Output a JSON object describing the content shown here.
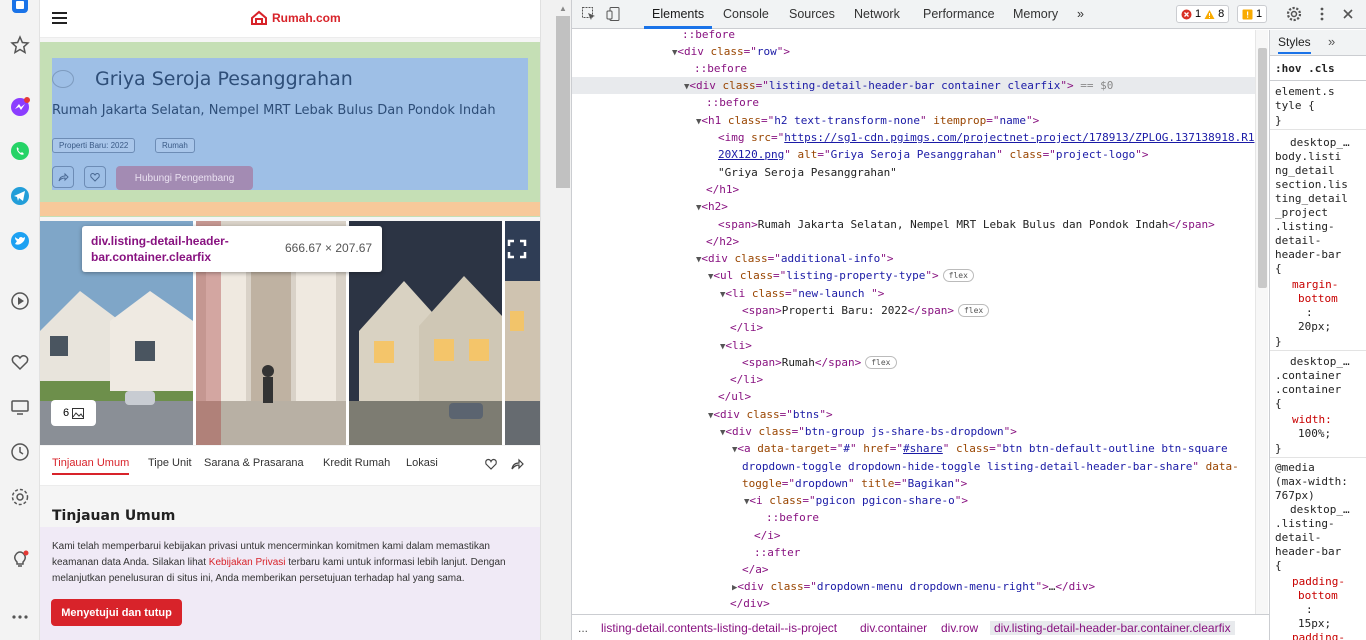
{
  "sidebar": {
    "icons": [
      "app-icon",
      "star-icon",
      "messenger-icon",
      "whatsapp-icon",
      "telegram-icon",
      "twitter-icon",
      "play-icon",
      "heart-icon",
      "screen-icon",
      "clock-icon",
      "settings-icon",
      "bulb-icon",
      "more-icon"
    ]
  },
  "site": {
    "brand": "Rumah.com",
    "project_title": "Griya Seroja Pesanggrahan",
    "project_subtitle": "Rumah Jakarta Selatan, Nempel MRT Lebak Bulus Dan Pondok Indah",
    "tags": [
      "Properti Baru: 2022",
      "Rumah"
    ],
    "contact_button": "Hubungi Pengembang",
    "photo_count": "6",
    "tabs": [
      "Tinjauan Umum",
      "Tipe Unit",
      "Sarana & Prasarana",
      "Kredit Rumah",
      "Lokasi"
    ],
    "section_title": "Tinjauan Umum",
    "cookie": {
      "text_before": "Kami telah memperbarui kebijakan privasi untuk mencerminkan komitmen kami dalam memastikan keamanan data Anda. Silakan lihat ",
      "link": "Kebijakan Privasi",
      "text_after": " terbaru kami untuk informasi lebih lanjut. Dengan melanjutkan penelusuran di situs ini, Anda memberikan persetujuan terhadap hal yang sama.",
      "button": "Menyetujui dan tutup"
    }
  },
  "tooltip": {
    "selector": "div.listing-detail-header-bar.container.clearfix",
    "dimensions": "666.67 × 207.67"
  },
  "devtools": {
    "tabs": [
      "Elements",
      "Console",
      "Sources",
      "Network",
      "Performance",
      "Memory"
    ],
    "more": "»",
    "errors": "1",
    "warnings": "8",
    "issues": "1",
    "styles_tab": "Styles",
    "styles_hov": ":hov",
    "styles_cls": ".cls",
    "breadcrumbs": [
      "...",
      "listing-detail.contents-listing-detail--is-project",
      "div.container",
      "div.row",
      "div.listing-detail-header-bar.container.clearfix"
    ],
    "dom": [
      "::before",
      "<div class=\"row\">",
      "::before",
      "<div class=\"listing-detail-header-bar container clearfix\"> == $0",
      "::before",
      "<h1 class=\"h2 text-transform-none\" itemprop=\"name\">",
      "<img src=\"https://sg1-cdn.pgimgs.com/projectnet-project/178913/ZPLOG.137138918.R1",
      "20X120.png\" alt=\"Griya Seroja Pesanggrahan\" class=\"project-logo\">",
      "\"Griya Seroja Pesanggrahan\"",
      "</h1>",
      "<h2>",
      "<span>Rumah Jakarta Selatan, Nempel MRT Lebak Bulus dan Pondok Indah</span>",
      "</h2>",
      "<div class=\"additional-info\">",
      "<ul class=\"listing-property-type\">",
      "<li class=\"new-launch \">",
      "<span>Properti Baru: 2022</span>",
      "</li>",
      "<li>",
      "<span>Rumah</span>",
      "</li>",
      "</ul>",
      "<div class=\"btns\">",
      "<div class=\"btn-group js-share-bs-dropdown\">",
      "<a data-target=\"#\" href=\"#share\" class=\"btn btn-default-outline   btn-square",
      "dropdown-toggle dropdown-hide-toggle listing-detail-header-bar-share\" data-",
      "toggle=\"dropdown\" title=\"Bagikan\">",
      "<i class=\"pgicon pgicon-share-o\">",
      "::before",
      "</i>",
      "::after",
      "</a>",
      "<div class=\"dropdown-menu dropdown-menu-right\">…</div>",
      "</div>"
    ],
    "flex_badge": "flex",
    "styles_lines": [
      "element.s",
      "tyle {",
      "}",
      "desktop_…",
      "body.listi",
      "ng_detail",
      "section.lis",
      "ting_detail",
      "_project",
      ".listing-",
      "detail-",
      "header-bar",
      "{",
      "margin-",
      "bottom",
      ":",
      "20px;",
      "}",
      "desktop_…",
      ".container",
      ".container",
      "{",
      "width:",
      "100%;",
      "}",
      "@media",
      "(max-width:",
      "767px)",
      "desktop_…",
      ".listing-",
      "detail-",
      "header-bar",
      "{",
      "padding-",
      "bottom",
      ":",
      "15px;",
      "padding-"
    ]
  }
}
